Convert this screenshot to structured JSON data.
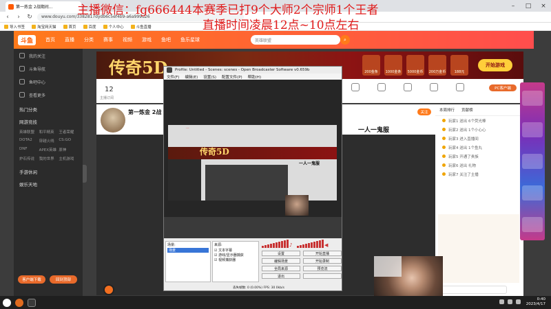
{
  "overlay": {
    "line1": "主播微信：fg666444本赛季已打9个大师2个宗师1个王者",
    "line2": "直播时间凌晨12点~10点左右"
  },
  "browser": {
    "tab_title": "第一炼金 2战期间...",
    "url": "www.douyu.com/3382817dydb6c5ef4b9-a6a999d26"
  },
  "bookmarks": [
    "导入书签",
    "淘宝网天猫",
    "首页",
    "百度",
    "个人中心",
    "斗鱼直播"
  ],
  "douyu": {
    "logo": "斗鱼",
    "nav": [
      "首页",
      "直播",
      "分类",
      "赛事",
      "视频",
      "游戏",
      "鱼吧",
      "鱼乐星球"
    ],
    "search_placeholder": "英雄联盟"
  },
  "sidebar": {
    "top_items": [
      "我的关注",
      "斗鱼导航",
      "鱼吧中心",
      "查看更多"
    ],
    "section_hot": "热门分类",
    "section_play": "网游竞技",
    "grid_items": [
      "英雄联盟",
      "和平精英",
      "王者荣耀",
      "DOTA2",
      "穿越火线",
      "CS:GO",
      "DNF",
      "APEX英雄",
      "原神",
      "炉石传说",
      "我的世界",
      "主机游戏"
    ],
    "section_mobile": "手游休闲",
    "section_ent": "娱乐天地",
    "btn_left": "客户端下载",
    "btn_right": "回到顶部"
  },
  "banner": {
    "title": "传奇5D",
    "action": "开始游戏",
    "prizes": [
      "200金条",
      "1000金条",
      "5000金币",
      "200万金币",
      "188元"
    ]
  },
  "infobar": {
    "count": "12",
    "count_label": "主播订阅",
    "pc_btn": "PC客户端"
  },
  "room": {
    "title": "第一炼金 2战",
    "follow": "关注",
    "slogan": "一人一鬼服"
  },
  "rpanel": {
    "tabs": [
      "本周排行",
      "贡献榜"
    ],
    "lines": [
      "玩家1 送出 6个荧光棒",
      "玩家2 送出 1个小心心",
      "玩家3 进入直播间",
      "玩家4 送出 1个鱼丸",
      "玩家5 开通了贵族",
      "玩家6 送出 礼物",
      "玩家7 关注了主播"
    ]
  },
  "obs": {
    "title": "Profile: Untitled - Scenes: scenes - Open Broadcaster Software v0.659b",
    "menu": [
      "文件(F)",
      "编辑(E)",
      "设置(S)",
      "配置文件(P)",
      "帮助(H)"
    ],
    "scenes_label": "场景:",
    "scene_item": "场景",
    "sources_label": "来源:",
    "sources": [
      "文本字幕",
      "游戏/显示器捕获",
      "视频捕获器"
    ],
    "buttons": [
      "设置",
      "开始直播",
      "编辑场景",
      "开始录制",
      "全局来源",
      "预览流",
      "退出",
      ""
    ],
    "status": "丢失帧数: 0 (0.00%)   FPS: 30   0kb/s"
  },
  "taskbar": {
    "time": "0:40",
    "date": "2023/4/17"
  }
}
